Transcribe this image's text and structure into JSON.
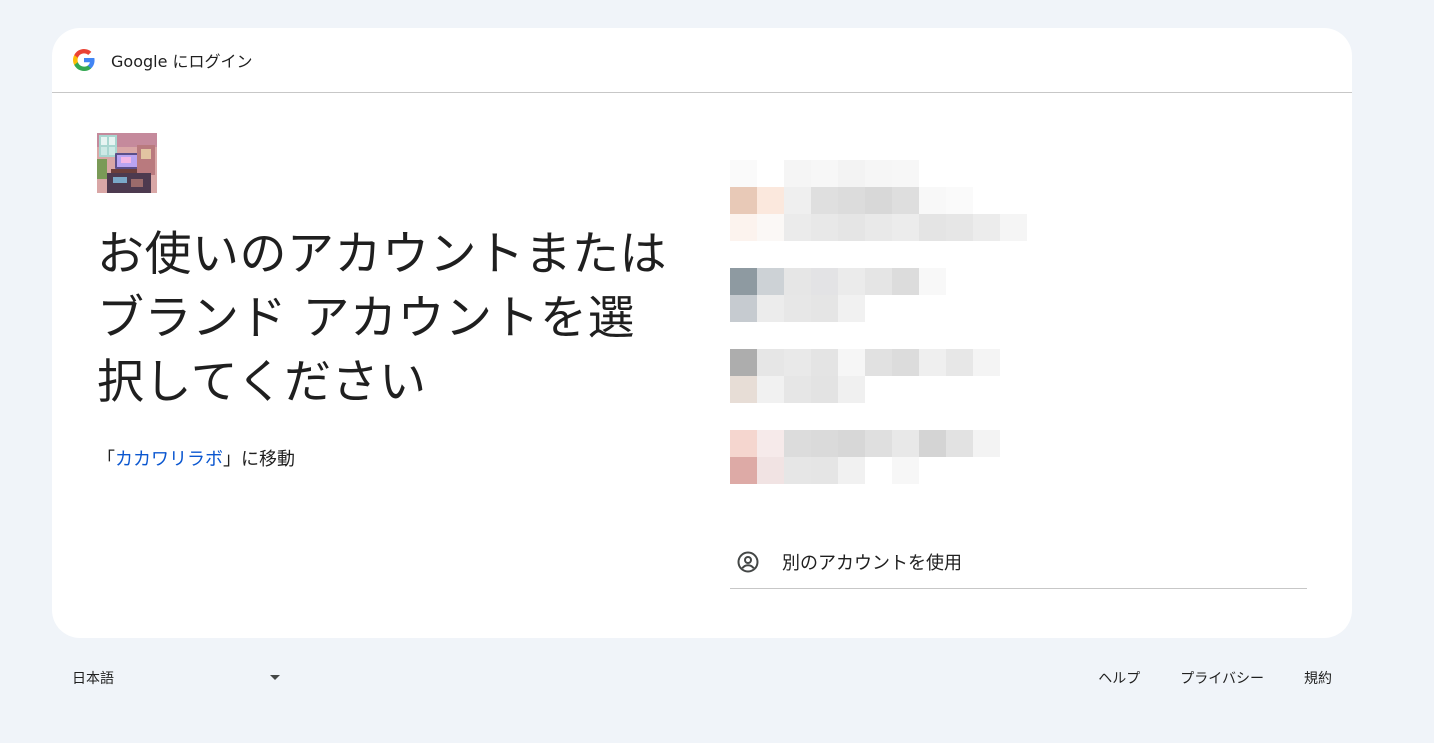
{
  "header": {
    "title": "Google にログイン",
    "logo_icon": "google-g-icon"
  },
  "main": {
    "app_logo_icon": "app-illustration-icon",
    "headline": "お使いのアカウントまたはブランド アカウントを選択してください",
    "redirect": {
      "prefix": "「",
      "app_name": "カカワリラボ",
      "suffix": "」に移動"
    }
  },
  "accounts": {
    "other_account_label": "別のアカウントを使用",
    "other_account_icon": "account-circle-icon"
  },
  "footer": {
    "language": "日本語",
    "links": [
      "ヘルプ",
      "プライバシー",
      "規約"
    ]
  },
  "colors": {
    "link": "#0b57d0",
    "background": "#f0f4f9",
    "card": "#ffffff"
  }
}
